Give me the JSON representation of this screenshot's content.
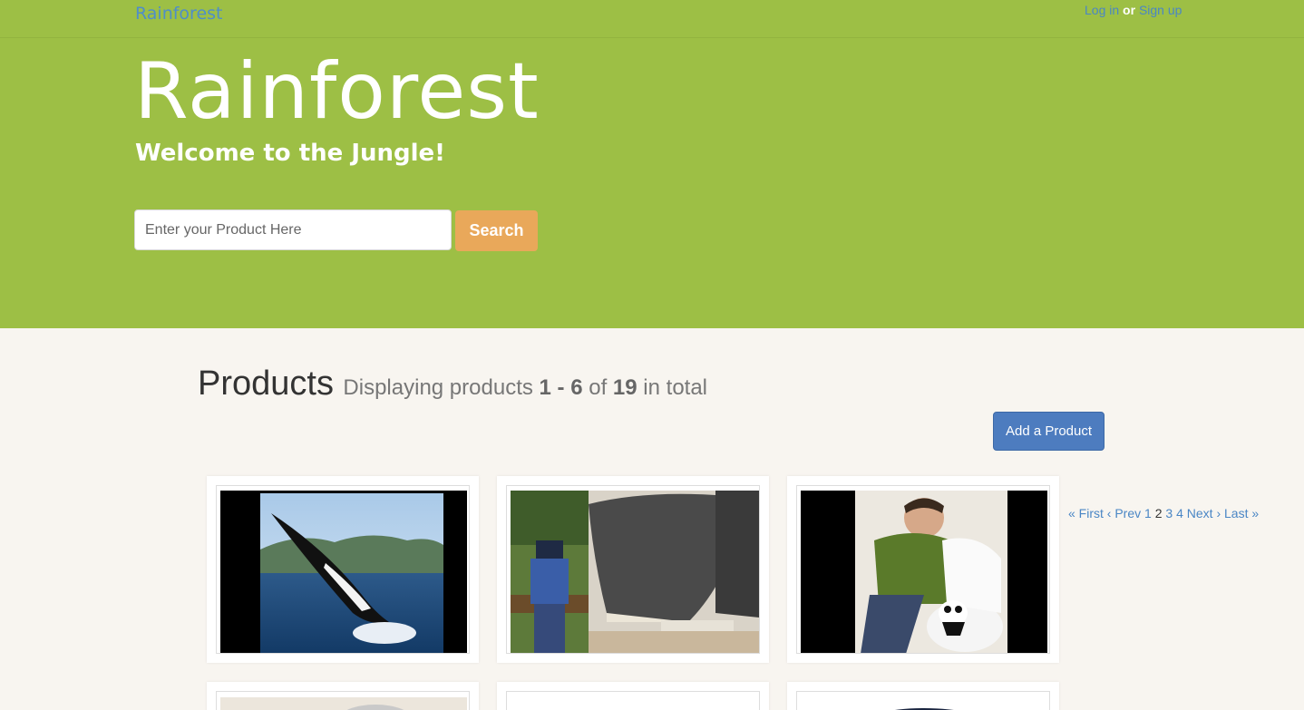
{
  "nav": {
    "brand": "Rainforest",
    "login": "Log in",
    "or": "or",
    "signup": "Sign up"
  },
  "hero": {
    "title": "Rainforest",
    "subtitle": "Welcome to the Jungle!",
    "search_placeholder": "Enter your Product Here",
    "search_button": "Search"
  },
  "products": {
    "heading": "Products",
    "display_prefix": "Displaying products",
    "range": "1 - 6",
    "of": "of",
    "total": "19",
    "in_total": "in total",
    "add_button": "Add a Product"
  },
  "pagination": {
    "first": "« First",
    "prev": "‹ Prev",
    "pages": [
      "1",
      "2",
      "3",
      "4"
    ],
    "current": "2",
    "next": "Next ›",
    "last": "Last »"
  },
  "colors": {
    "hero_green": "#9dbf45",
    "link_blue": "#4a86c5",
    "search_orange": "#e9a85a",
    "add_blue": "#4d7cbf",
    "page_bg": "#f8f5f0"
  }
}
